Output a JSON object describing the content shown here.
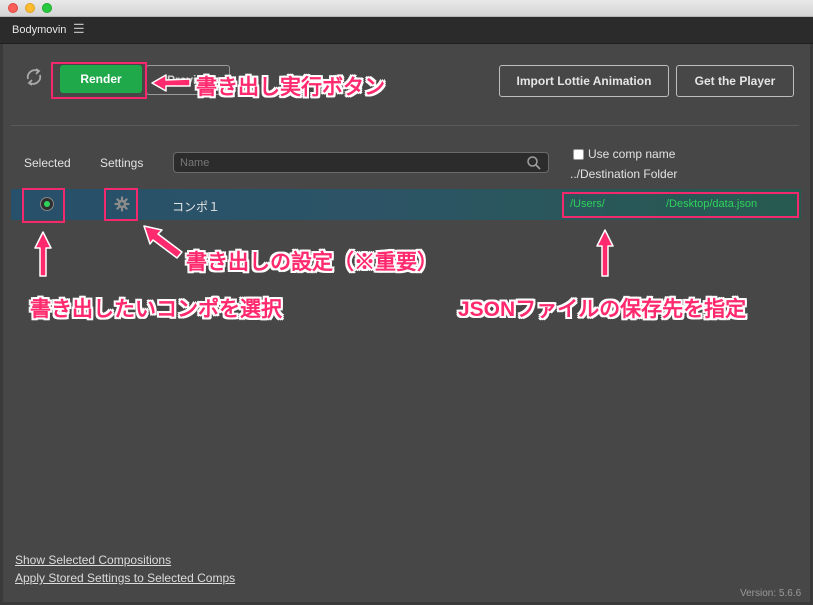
{
  "window": {
    "panel_title": "Bodymovin",
    "menu_icon": "hamburger-menu-icon"
  },
  "toolbar": {
    "render_label": "Render",
    "preview_label": "Previ",
    "import_label": "Import Lottie Animation",
    "player_label": "Get the Player"
  },
  "columns": {
    "selected": "Selected",
    "settings": "Settings"
  },
  "search": {
    "placeholder": "Name"
  },
  "options": {
    "use_comp_name": "Use comp name",
    "destination_folder": "../Destination Folder"
  },
  "rows": [
    {
      "name": "コンポ１",
      "destination": "/Users/                    /Desktop/data.json",
      "selected": true
    }
  ],
  "footer": {
    "show_selected": "Show Selected Compositions",
    "apply_settings": "Apply Stored Settings to Selected Comps",
    "version": "Version: 5.6.6"
  },
  "annotations": {
    "render": "書き出し実行ボタン",
    "settings": "書き出しの設定（※重要）",
    "select": "書き出したいコンポを選択",
    "destination": "JSONファイルの保存先を指定"
  },
  "colors": {
    "accent": "#1fa94a",
    "annotation": "#ff2a6d",
    "path": "#2ed35c"
  }
}
